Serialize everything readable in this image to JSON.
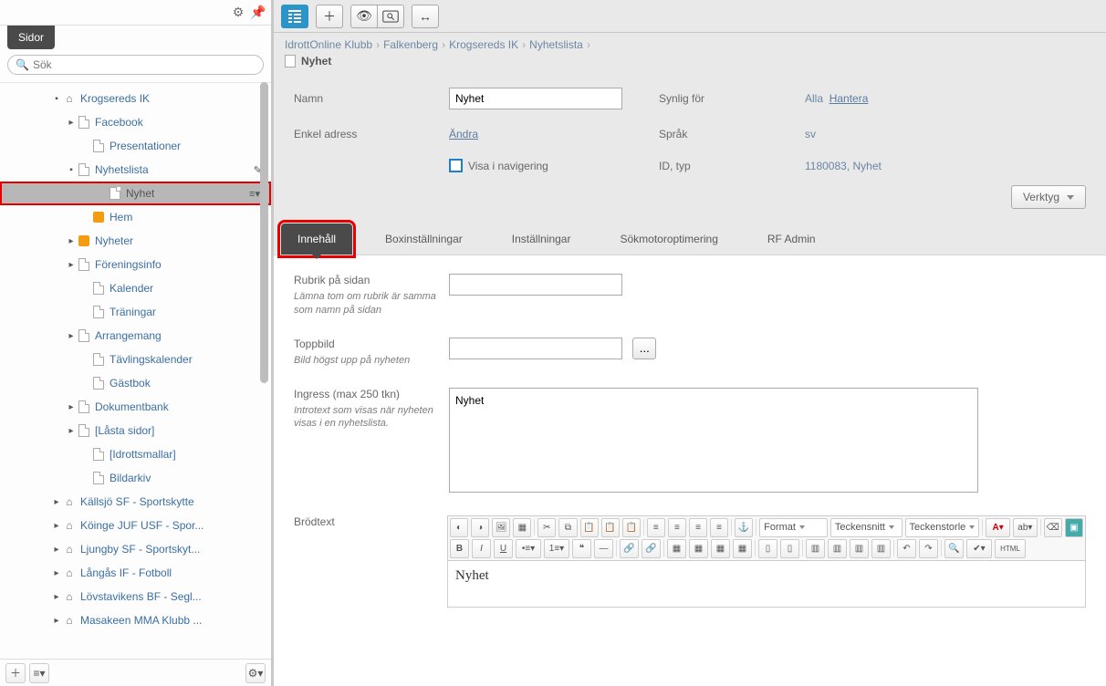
{
  "sidebar": {
    "tab_label": "Sidor",
    "search_placeholder": "Sök",
    "tree": [
      {
        "label": "Krogsereds IK",
        "level": 0,
        "expander": true,
        "expanded": true,
        "icon": "home"
      },
      {
        "label": "Facebook",
        "level": 1,
        "expander": true,
        "icon": "page"
      },
      {
        "label": "Presentationer",
        "level": 2,
        "icon": "page"
      },
      {
        "label": "Nyhetslista",
        "level": 1,
        "expander": true,
        "expanded": true,
        "icon": "page",
        "edit": true
      },
      {
        "label": "Nyhet",
        "level": 3,
        "icon": "page",
        "selected": true,
        "menu": true
      },
      {
        "label": "Hem",
        "level": 2,
        "icon": "orange"
      },
      {
        "label": "Nyheter",
        "level": 1,
        "expander": true,
        "icon": "orange"
      },
      {
        "label": "Föreningsinfo",
        "level": 1,
        "expander": true,
        "icon": "page"
      },
      {
        "label": "Kalender",
        "level": 2,
        "icon": "page"
      },
      {
        "label": "Träningar",
        "level": 2,
        "icon": "page"
      },
      {
        "label": "Arrangemang",
        "level": 1,
        "expander": true,
        "icon": "page"
      },
      {
        "label": "Tävlingskalender",
        "level": 2,
        "icon": "page"
      },
      {
        "label": "Gästbok",
        "level": 2,
        "icon": "page"
      },
      {
        "label": "Dokumentbank",
        "level": 1,
        "expander": true,
        "icon": "page"
      },
      {
        "label": "[Låsta sidor]",
        "level": 1,
        "expander": true,
        "icon": "page"
      },
      {
        "label": "[Idrottsmallar]",
        "level": 2,
        "icon": "page"
      },
      {
        "label": "Bildarkiv",
        "level": 2,
        "icon": "page"
      },
      {
        "label": "Källsjö SF - Sportskytte",
        "level": 0,
        "expander": true,
        "icon": "home"
      },
      {
        "label": "Köinge JUF USF - Spor...",
        "level": 0,
        "expander": true,
        "icon": "home"
      },
      {
        "label": "Ljungby SF - Sportskyt...",
        "level": 0,
        "expander": true,
        "icon": "home"
      },
      {
        "label": "Långås IF - Fotboll",
        "level": 0,
        "expander": true,
        "icon": "home"
      },
      {
        "label": "Lövstavikens BF - Segl...",
        "level": 0,
        "expander": true,
        "icon": "home"
      },
      {
        "label": "Masakeen MMA Klubb ...",
        "level": 0,
        "expander": true,
        "icon": "home"
      }
    ]
  },
  "breadcrumb": [
    "IdrottOnline Klubb",
    "Falkenberg",
    "Krogsereds IK",
    "Nyhetslista"
  ],
  "page_title": "Nyhet",
  "props": {
    "name_label": "Namn",
    "name_value": "Nyhet",
    "address_label": "Enkel adress",
    "address_link": "Ändra",
    "nav_label": "Visa i navigering",
    "visible_label": "Synlig för",
    "visible_value": "Alla",
    "manage_link": "Hantera",
    "lang_label": "Språk",
    "lang_value": "sv",
    "id_label": "ID, typ",
    "id_value": "1180083, Nyhet",
    "tools_label": "Verktyg"
  },
  "tabs": [
    "Innehåll",
    "Boxinställningar",
    "Inställningar",
    "Sökmotoroptimering",
    "RF Admin"
  ],
  "content": {
    "rubrik_label": "Rubrik på sidan",
    "rubrik_hint": "Lämna tom om rubrik är samma som namn på sidan",
    "toppbild_label": "Toppbild",
    "toppbild_hint": "Bild högst upp på nyheten",
    "browse_label": "...",
    "ingress_label": "Ingress (max 250 tkn)",
    "ingress_hint": "Introtext som visas när nyheten visas i en nyhetslista.",
    "ingress_value": "Nyhet",
    "brodtext_label": "Brödtext",
    "richtext": {
      "format": "Format",
      "font": "Teckensnitt",
      "size": "Teckenstorle",
      "html": "HTML",
      "content": "Nyhet"
    }
  }
}
